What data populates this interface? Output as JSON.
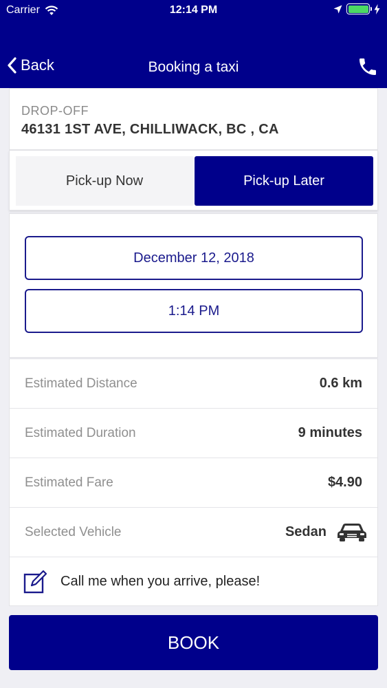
{
  "status_bar": {
    "carrier": "Carrier",
    "time": "12:14 PM",
    "wifi_icon": "wifi-icon",
    "location_icon": "location-arrow-icon",
    "battery_icon": "battery-icon",
    "charging_icon": "bolt-icon"
  },
  "nav": {
    "back_label": "Back",
    "title": "Booking a taxi",
    "phone_icon": "phone-icon"
  },
  "dropoff": {
    "label": "DROP-OFF",
    "address": "46131 1ST AVE, CHILLIWACK, BC , CA"
  },
  "pickup_toggle": {
    "now_label": "Pick-up Now",
    "later_label": "Pick-up Later",
    "selected": "Pick-up Later"
  },
  "schedule": {
    "date": "December 12, 2018",
    "time": "1:14 PM"
  },
  "details": [
    {
      "label": "Estimated Distance",
      "value": "0.6 km"
    },
    {
      "label": "Estimated Duration",
      "value": "9 minutes"
    },
    {
      "label": "Estimated Fare",
      "value": "$4.90"
    },
    {
      "label": "Selected Vehicle",
      "value": "Sedan"
    }
  ],
  "note": {
    "text": "Call me when you arrive, please!",
    "icon": "edit-note-icon"
  },
  "book_label": "BOOK",
  "colors": {
    "brand": "#00008b",
    "battery": "#4cd964",
    "background": "#efeff4"
  }
}
